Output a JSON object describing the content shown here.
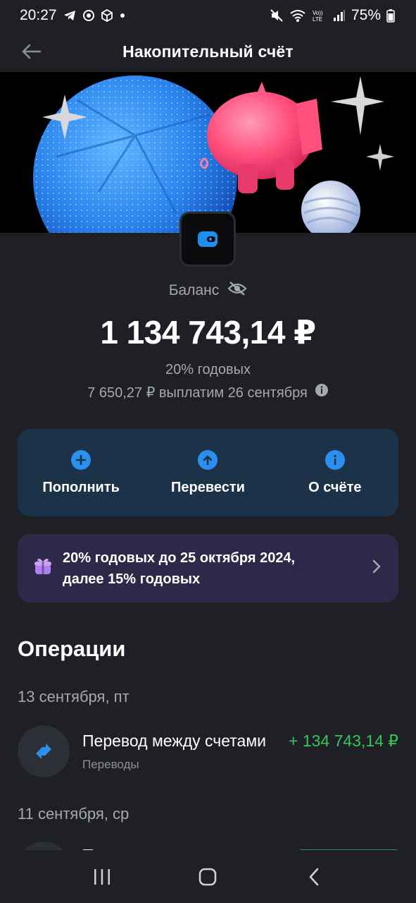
{
  "status_bar": {
    "time": "20:27",
    "battery": "75%",
    "icons": [
      "telegram-icon",
      "sync-icon",
      "package-icon",
      "dot-icon",
      "mute-icon",
      "wifi-icon",
      "volte-icon",
      "signal-icon",
      "battery-icon"
    ]
  },
  "header": {
    "title": "Накопительный счёт"
  },
  "balance": {
    "label": "Баланс",
    "amount": "1 134 743,14 ₽",
    "rate": "20% годовых",
    "payout": "7 650,27 ₽ выплатим 26 сентября"
  },
  "actions": [
    {
      "label": "Пополнить",
      "icon": "plus-icon"
    },
    {
      "label": "Перевести",
      "icon": "arrow-up-icon"
    },
    {
      "label": "О счёте",
      "icon": "info-icon"
    }
  ],
  "promo": {
    "text_line1": "20% годовых до 25 октября 2024,",
    "text_line2": "далее 15% годовых"
  },
  "operations": {
    "title": "Операции",
    "groups": [
      {
        "date": "13 сентября, пт",
        "items": [
          {
            "name": "Перевод между счетами",
            "amount": "+ 134 743,14 ₽",
            "category": "Переводы"
          }
        ]
      },
      {
        "date": "11 сентября, ср",
        "items": []
      }
    ]
  },
  "colors": {
    "background": "#1e2025",
    "actions_card": "#1b3248",
    "promo_card": "#2c2a48",
    "accent_blue": "#2b8ff0",
    "income_green": "#34c55a",
    "muted_text": "#a5a8ae"
  }
}
